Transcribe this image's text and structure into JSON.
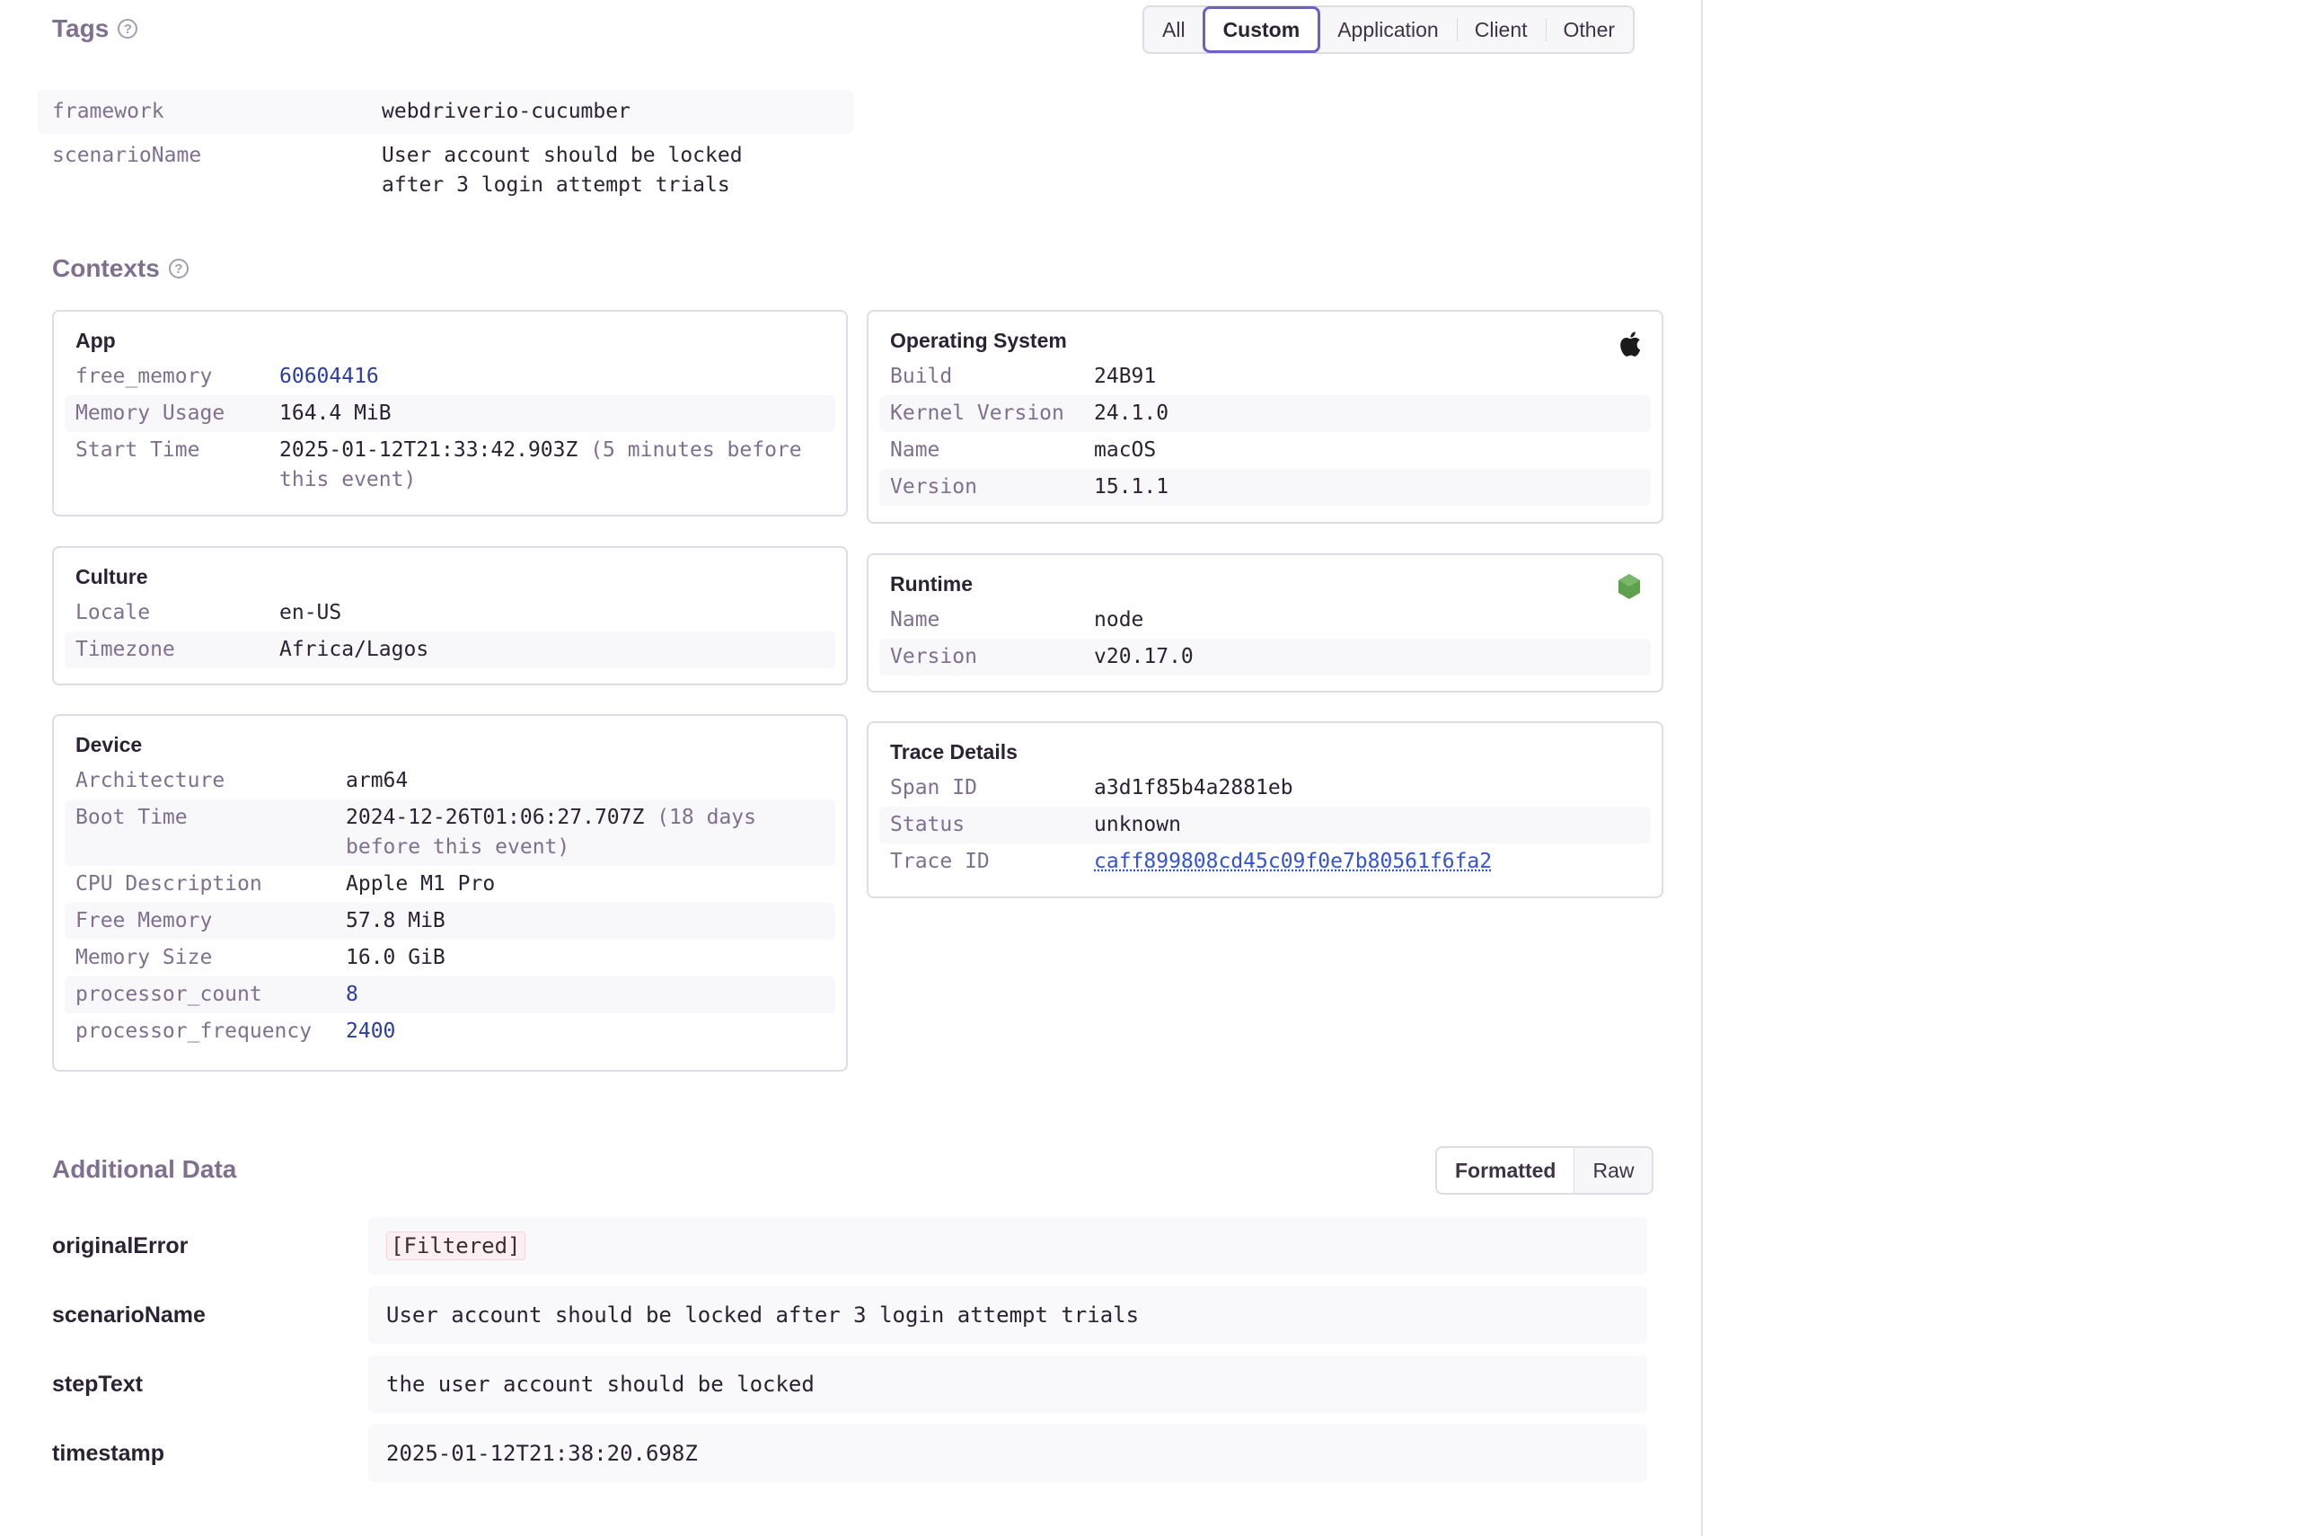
{
  "tags": {
    "title": "Tags",
    "filters": [
      "All",
      "Custom",
      "Application",
      "Client",
      "Other"
    ],
    "active_filter": "Custom",
    "rows": [
      {
        "key": "framework",
        "value": "webdriverio-cucumber"
      },
      {
        "key": "scenarioName",
        "value": "User account should be locked\nafter 3 login attempt trials"
      }
    ]
  },
  "contexts": {
    "title": "Contexts",
    "app": {
      "title": "App",
      "free_memory_key": "free_memory",
      "free_memory": "60604416",
      "memory_usage_key": "Memory Usage",
      "memory_usage": "164.4 MiB",
      "start_time_key": "Start Time",
      "start_time": "2025-01-12T21:33:42.903Z",
      "start_time_rel": "(5 minutes before this event)"
    },
    "culture": {
      "title": "Culture",
      "locale_key": "Locale",
      "locale": "en-US",
      "timezone_key": "Timezone",
      "timezone": "Africa/Lagos"
    },
    "device": {
      "title": "Device",
      "arch_key": "Architecture",
      "arch": "arm64",
      "boot_key": "Boot Time",
      "boot": "2024-12-26T01:06:27.707Z",
      "boot_rel": "(18 days before this event)",
      "cpu_key": "CPU Description",
      "cpu": "Apple M1 Pro",
      "free_mem_key": "Free Memory",
      "free_mem": "57.8 MiB",
      "mem_size_key": "Memory Size",
      "mem_size": "16.0 GiB",
      "proc_count_key": "processor_count",
      "proc_count": "8",
      "proc_freq_key": "processor_frequency",
      "proc_freq": "2400"
    },
    "os": {
      "title": "Operating System",
      "icon": "apple-icon",
      "build_key": "Build",
      "build": "24B91",
      "kernel_key": "Kernel Version",
      "kernel": "24.1.0",
      "name_key": "Name",
      "name": "macOS",
      "version_key": "Version",
      "version": "15.1.1"
    },
    "runtime": {
      "title": "Runtime",
      "icon": "nodejs-icon",
      "name_key": "Name",
      "name": "node",
      "version_key": "Version",
      "version": "v20.17.0"
    },
    "trace": {
      "title": "Trace Details",
      "span_key": "Span ID",
      "span": "a3d1f85b4a2881eb",
      "status_key": "Status",
      "status": "unknown",
      "trace_key": "Trace ID",
      "trace": "caff899808cd45c09f0e7b80561f6fa2"
    }
  },
  "additional": {
    "title": "Additional Data",
    "view_options": [
      "Formatted",
      "Raw"
    ],
    "active_view": "Formatted",
    "rows": [
      {
        "key": "originalError",
        "value": "[Filtered]"
      },
      {
        "key": "scenarioName",
        "value": "User account should be locked after 3 login attempt trials"
      },
      {
        "key": "stepText",
        "value": "the user account should be locked"
      },
      {
        "key": "timestamp",
        "value": "2025-01-12T21:38:20.698Z"
      }
    ]
  },
  "colors": {
    "accent": "#6c5fc7",
    "muted": "#80708f",
    "node_green": "#5fa04e"
  }
}
